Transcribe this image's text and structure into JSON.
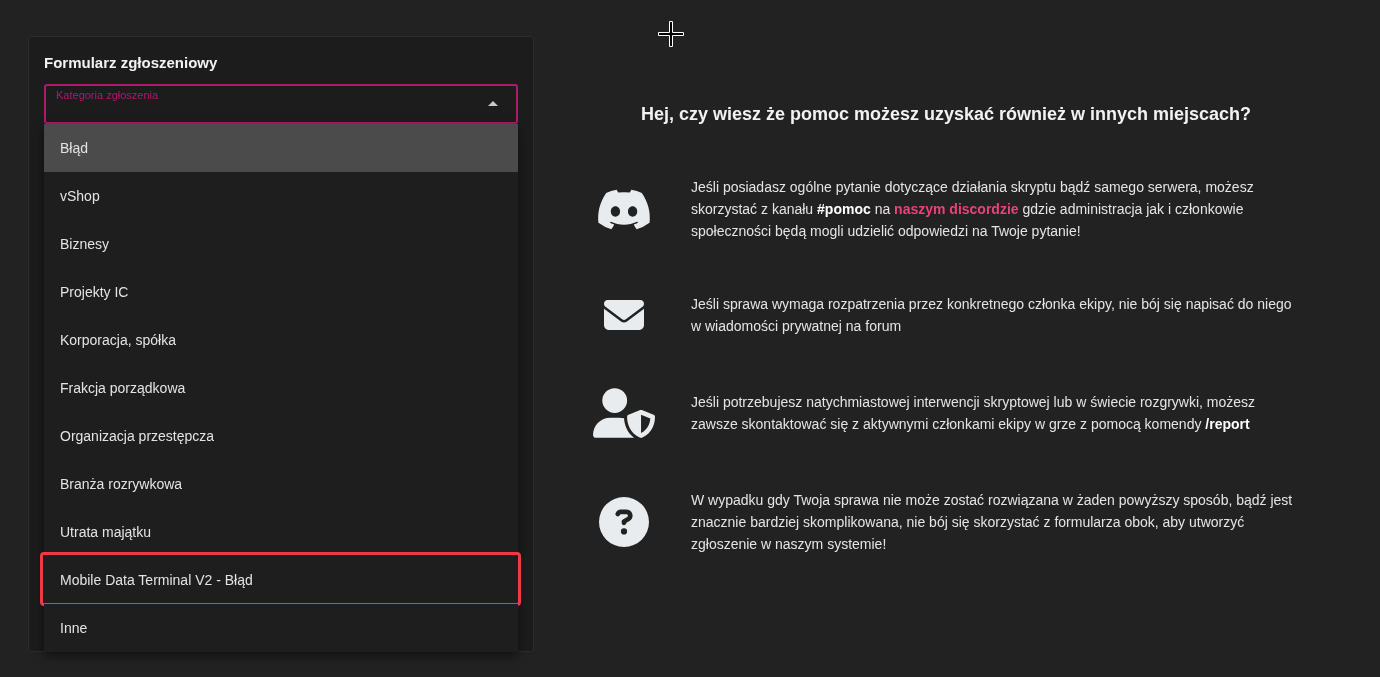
{
  "form": {
    "title": "Formularz zgłoszeniowy",
    "category_field": {
      "label": "Kategoria zgłoszenia",
      "expanded": true
    },
    "options": [
      {
        "label": "Błąd",
        "selected": true,
        "annotated": false
      },
      {
        "label": "vShop",
        "selected": false,
        "annotated": false
      },
      {
        "label": "Biznesy",
        "selected": false,
        "annotated": false
      },
      {
        "label": "Projekty IC",
        "selected": false,
        "annotated": false
      },
      {
        "label": "Korporacja, spółka",
        "selected": false,
        "annotated": false
      },
      {
        "label": "Frakcja porządkowa",
        "selected": false,
        "annotated": false
      },
      {
        "label": "Organizacja przestępcza",
        "selected": false,
        "annotated": false
      },
      {
        "label": "Branża rozrywkowa",
        "selected": false,
        "annotated": false
      },
      {
        "label": "Utrata majątku",
        "selected": false,
        "annotated": false
      },
      {
        "label": "Mobile Data Terminal V2 - Błąd",
        "selected": false,
        "annotated": true
      },
      {
        "label": "Inne",
        "selected": false,
        "annotated": false
      }
    ]
  },
  "help": {
    "heading": "Hej, czy wiesz że pomoc możesz uzyskać również w innych miejscach?",
    "items": [
      {
        "segments": [
          {
            "kind": "text",
            "text": "Jeśli posiadasz ogólne pytanie dotyczące działania skryptu bądź samego serwera, możesz skorzystać z kanału "
          },
          {
            "kind": "bold",
            "text": "#pomoc"
          },
          {
            "kind": "text",
            "text": " na "
          },
          {
            "kind": "link",
            "text": "naszym discordzie"
          },
          {
            "kind": "text",
            "text": " gdzie administracja jak i członkowie społeczności będą mogli udzielić odpowiedzi na Twoje pytanie!"
          }
        ]
      },
      {
        "segments": [
          {
            "kind": "text",
            "text": "Jeśli sprawa wymaga rozpatrzenia przez konkretnego członka ekipy, nie bój się napisać do niego w wiadomości prywatnej na forum"
          }
        ]
      },
      {
        "segments": [
          {
            "kind": "text",
            "text": "Jeśli potrzebujesz natychmiastowej interwencji skryptowej lub w świecie rozgrywki, możesz zawsze skontaktować się z aktywnymi członkami ekipy w grze z pomocą komendy "
          },
          {
            "kind": "bold",
            "text": "/report"
          }
        ]
      },
      {
        "segments": [
          {
            "kind": "text",
            "text": "W wypadku gdy Twoja sprawa nie może zostać rozwiązana w żaden powyższy sposób, bądź jest znacznie bardziej skomplikowana, nie bój się skorzystać z formularza obok, aby utworzyć zgłoszenie w naszym systemie!"
          }
        ]
      }
    ]
  }
}
